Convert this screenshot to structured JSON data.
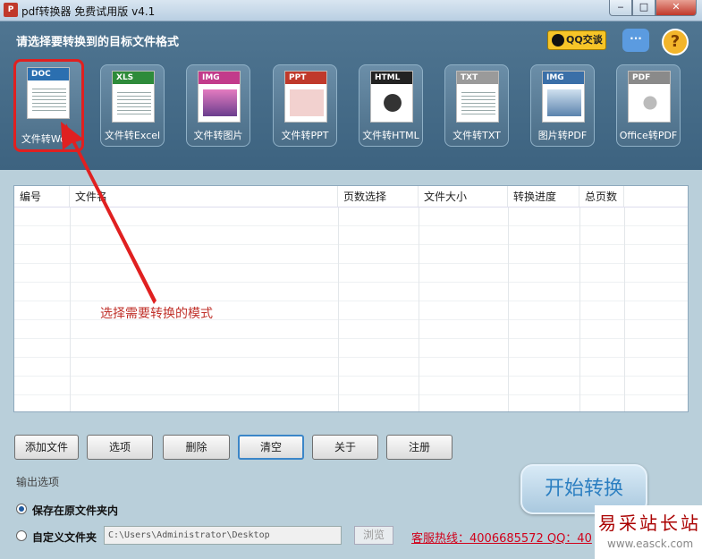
{
  "window": {
    "title": "pdf转换器 免费试用版 v4.1",
    "app_icon": "pdf-app-icon"
  },
  "header": {
    "title": "请选择要转换到的目标文件格式",
    "qq_badge": "QQ交谈",
    "help": "?",
    "chat": "···"
  },
  "tiles": [
    {
      "band": "DOC",
      "label": "文件转Word",
      "band_color": "#2b6fb0"
    },
    {
      "band": "XLS",
      "label": "文件转Excel",
      "band_color": "#2e8b3a"
    },
    {
      "band": "IMG",
      "label": "文件转图片",
      "band_color": "#c23b8b"
    },
    {
      "band": "PPT",
      "label": "文件转PPT",
      "band_color": "#c0392b"
    },
    {
      "band": "HTML",
      "label": "文件转HTML",
      "band_color": "#222222"
    },
    {
      "band": "TXT",
      "label": "文件转TXT",
      "band_color": "#9a9a9a"
    },
    {
      "band": "IMG",
      "label": "图片转PDF",
      "band_color": "#3a6fa8"
    },
    {
      "band": "PDF",
      "label": "Office转PDF",
      "band_color": "#8a8a8a"
    }
  ],
  "table": {
    "columns": [
      "编号",
      "文件名",
      "页数选择",
      "文件大小",
      "转换进度",
      "总页数"
    ]
  },
  "annotation": "选择需要转换的模式",
  "buttons": {
    "add_file": "添加文件",
    "options": "选项",
    "delete": "删除",
    "clear": "清空",
    "about": "关于",
    "register": "注册"
  },
  "output": {
    "section": "输出选项",
    "save_in_source": "保存在原文件夹内",
    "custom_folder": "自定义文件夹",
    "path": "C:\\Users\\Administrator\\Desktop",
    "browse": "浏览"
  },
  "hotline": "客服热线：4006685572 QQ：40",
  "start": "开始转换",
  "watermark": {
    "title": "易采站长站",
    "url": "www.easck.com"
  }
}
